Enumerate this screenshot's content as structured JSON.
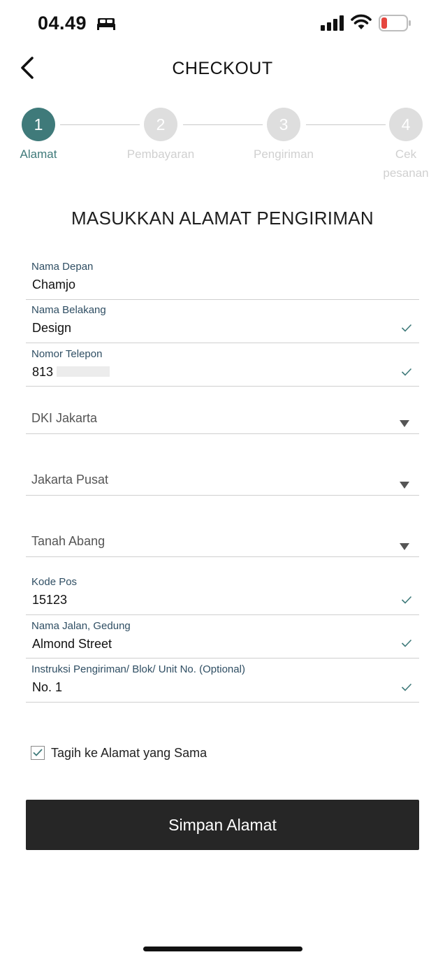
{
  "status_bar": {
    "time": "04.49",
    "icons": [
      "bed-icon",
      "signal-icon",
      "wifi-icon",
      "battery-low-icon"
    ],
    "battery_color": "#e5463f"
  },
  "header": {
    "title": "CHECKOUT",
    "back_icon": "chevron-left-icon"
  },
  "stepper": {
    "active_color": "#3f7a7a",
    "inactive_color": "#dedede",
    "steps": [
      {
        "number": "1",
        "label": "Alamat",
        "active": true
      },
      {
        "number": "2",
        "label": "Pembayaran",
        "active": false
      },
      {
        "number": "3",
        "label": "Pengiriman",
        "active": false
      },
      {
        "number": "4",
        "label_line1": "Cek",
        "label_line2": "pesanan",
        "active": false
      }
    ]
  },
  "form": {
    "heading": "MASUKKAN ALAMAT PENGIRIMAN",
    "first_name": {
      "label": "Nama Depan",
      "value": "Chamjo"
    },
    "last_name": {
      "label": "Nama Belakang",
      "value": "Design"
    },
    "phone": {
      "label": "Nomor Telepon",
      "value": "813"
    },
    "province": {
      "value": "DKI Jakarta"
    },
    "city": {
      "value": "Jakarta Pusat"
    },
    "district": {
      "value": "Tanah Abang"
    },
    "postal_code": {
      "label": "Kode Pos",
      "value": "15123"
    },
    "street": {
      "label": "Nama Jalan, Gedung",
      "value": "Almond Street"
    },
    "instructions": {
      "label": "Instruksi Pengiriman/ Blok/ Unit No. (Optional)",
      "value": "No. 1"
    },
    "same_billing": {
      "label": "Tagih ke Alamat yang Sama",
      "checked": true
    },
    "check_color": "#3f7a7a"
  },
  "actions": {
    "save_label": "Simpan Alamat"
  }
}
